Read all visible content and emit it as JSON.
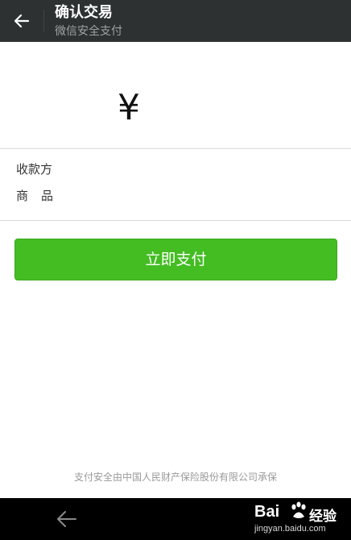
{
  "header": {
    "title": "确认交易",
    "subtitle": "微信安全支付"
  },
  "amount": {
    "currency_symbol": "¥"
  },
  "info": {
    "payee_label": "收款方",
    "product_label": "商品"
  },
  "actions": {
    "pay_label": "立即支付"
  },
  "footer": {
    "note": "支付安全由中国人民财产保险股份有限公司承保"
  },
  "watermark": {
    "logo": "Bai",
    "jingyan": "经验",
    "url": "jingyan.baidu.com"
  },
  "colors": {
    "header_bg": "#2d3132",
    "accent_green": "#44bd23",
    "nav_bg": "#000000"
  }
}
